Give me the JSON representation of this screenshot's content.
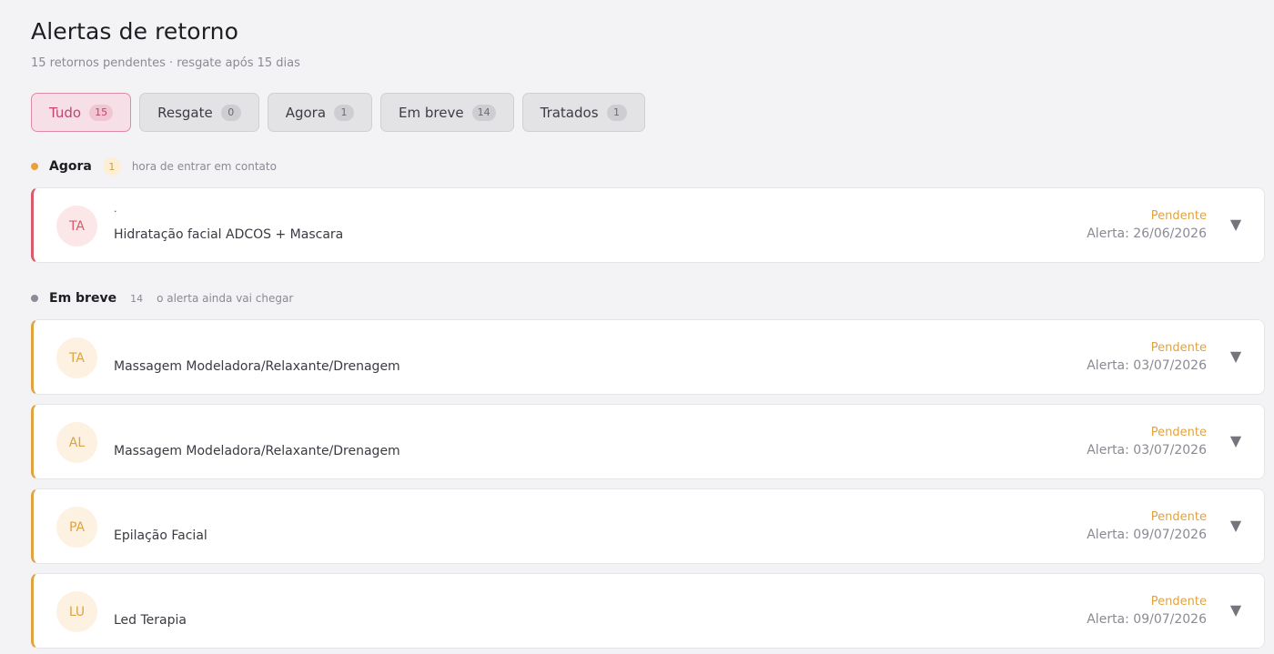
{
  "header": {
    "title": "Alertas de retorno",
    "subtitle": "15 retornos pendentes · resgate após 15 dias"
  },
  "tabs": [
    {
      "label": "Tudo",
      "count": "15",
      "active": true
    },
    {
      "label": "Resgate",
      "count": "0"
    },
    {
      "label": "Agora",
      "count": "1"
    },
    {
      "label": "Em breve",
      "count": "14"
    },
    {
      "label": "Tratados",
      "count": "1"
    }
  ],
  "sections": {
    "now": {
      "title": "Agora",
      "count": "1",
      "description": "hora de entrar em contato",
      "dot_color": "#e9a23b"
    },
    "soon": {
      "title": "Em breve",
      "count": "14",
      "description": "o alerta ainda vai chegar",
      "dot_color": "#8c8c96"
    }
  },
  "cards": [
    {
      "initials": "TA",
      "name": ".",
      "service": "Hidratação facial ADCOS + Mascara",
      "status": "Pendente",
      "alert": "Alerta: 26/06/2026"
    },
    {
      "initials": "TA",
      "name": "",
      "service": "Massagem Modeladora/Relaxante/Drenagem",
      "status": "Pendente",
      "alert": "Alerta: 03/07/2026"
    },
    {
      "initials": "AL",
      "name": "",
      "service": "Massagem Modeladora/Relaxante/Drenagem",
      "status": "Pendente",
      "alert": "Alerta: 03/07/2026"
    },
    {
      "initials": "PA",
      "name": "",
      "service": "Epilação Facial",
      "status": "Pendente",
      "alert": "Alerta: 09/07/2026"
    },
    {
      "initials": "LU",
      "name": "",
      "service": "Led Terapia",
      "status": "Pendente",
      "alert": "Alerta: 09/07/2026"
    }
  ],
  "icons": {
    "expand": "chevron-down-icon"
  },
  "colors": {
    "accent_pink": "#c0466d",
    "now_red": "#d95a6a",
    "soon_orange": "#e0a341",
    "status_orange": "#e0a341"
  }
}
